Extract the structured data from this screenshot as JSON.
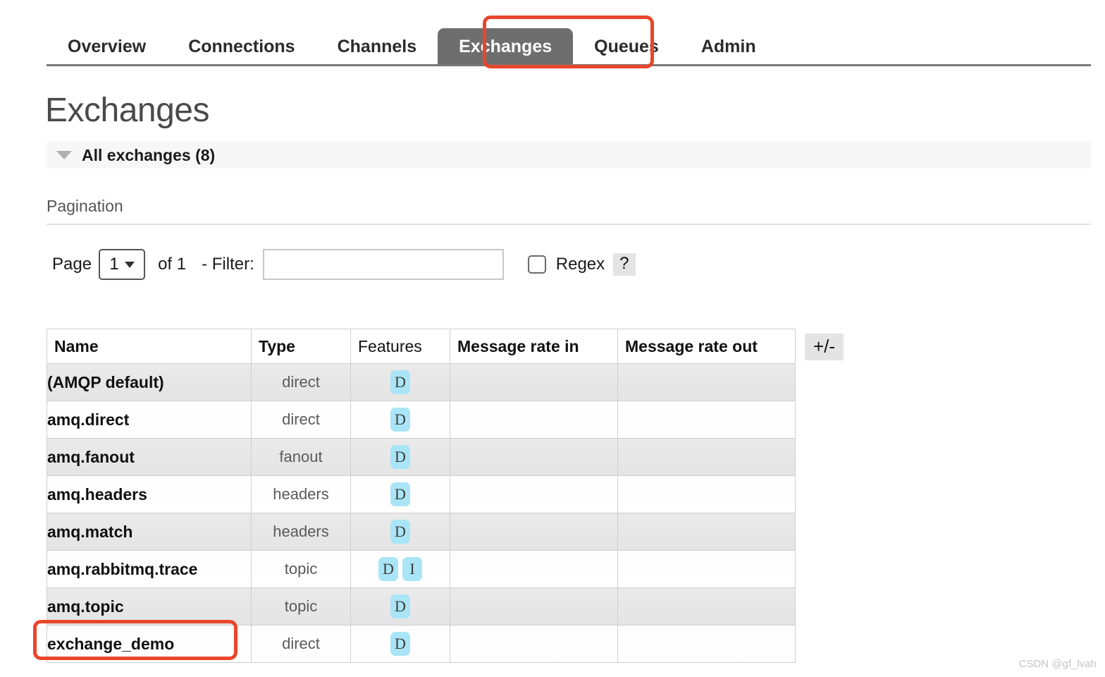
{
  "nav": {
    "tabs": [
      {
        "label": "Overview",
        "active": false
      },
      {
        "label": "Connections",
        "active": false
      },
      {
        "label": "Channels",
        "active": false
      },
      {
        "label": "Exchanges",
        "active": true
      },
      {
        "label": "Queues",
        "active": false
      },
      {
        "label": "Admin",
        "active": false
      }
    ]
  },
  "page": {
    "title": "Exchanges",
    "section_label": "All exchanges (8)",
    "pagination_label": "Pagination"
  },
  "pagination": {
    "page_label": "Page",
    "page_value": "1",
    "page_options": [
      "1"
    ],
    "of_label": "of 1",
    "filter_label": "- Filter:",
    "filter_value": "",
    "filter_placeholder": "",
    "regex_label": "Regex",
    "regex_checked": false,
    "help_label": "?"
  },
  "table": {
    "columns": [
      "Name",
      "Type",
      "Features",
      "Message rate in",
      "Message rate out"
    ],
    "toggle_columns_label": "+/-",
    "rows": [
      {
        "name": "(AMQP default)",
        "type": "direct",
        "features": [
          "D"
        ],
        "rate_in": "",
        "rate_out": ""
      },
      {
        "name": "amq.direct",
        "type": "direct",
        "features": [
          "D"
        ],
        "rate_in": "",
        "rate_out": ""
      },
      {
        "name": "amq.fanout",
        "type": "fanout",
        "features": [
          "D"
        ],
        "rate_in": "",
        "rate_out": ""
      },
      {
        "name": "amq.headers",
        "type": "headers",
        "features": [
          "D"
        ],
        "rate_in": "",
        "rate_out": ""
      },
      {
        "name": "amq.match",
        "type": "headers",
        "features": [
          "D"
        ],
        "rate_in": "",
        "rate_out": ""
      },
      {
        "name": "amq.rabbitmq.trace",
        "type": "topic",
        "features": [
          "D",
          "I"
        ],
        "rate_in": "",
        "rate_out": ""
      },
      {
        "name": "amq.topic",
        "type": "topic",
        "features": [
          "D"
        ],
        "rate_in": "",
        "rate_out": ""
      },
      {
        "name": "exchange_demo",
        "type": "direct",
        "features": [
          "D"
        ],
        "rate_in": "",
        "rate_out": ""
      }
    ]
  },
  "annotations": {
    "color": "#e8462a",
    "targets": [
      "Exchanges tab",
      "exchange_demo row name"
    ]
  },
  "watermark": {
    "text": "CSDN @gf_lvah"
  }
}
